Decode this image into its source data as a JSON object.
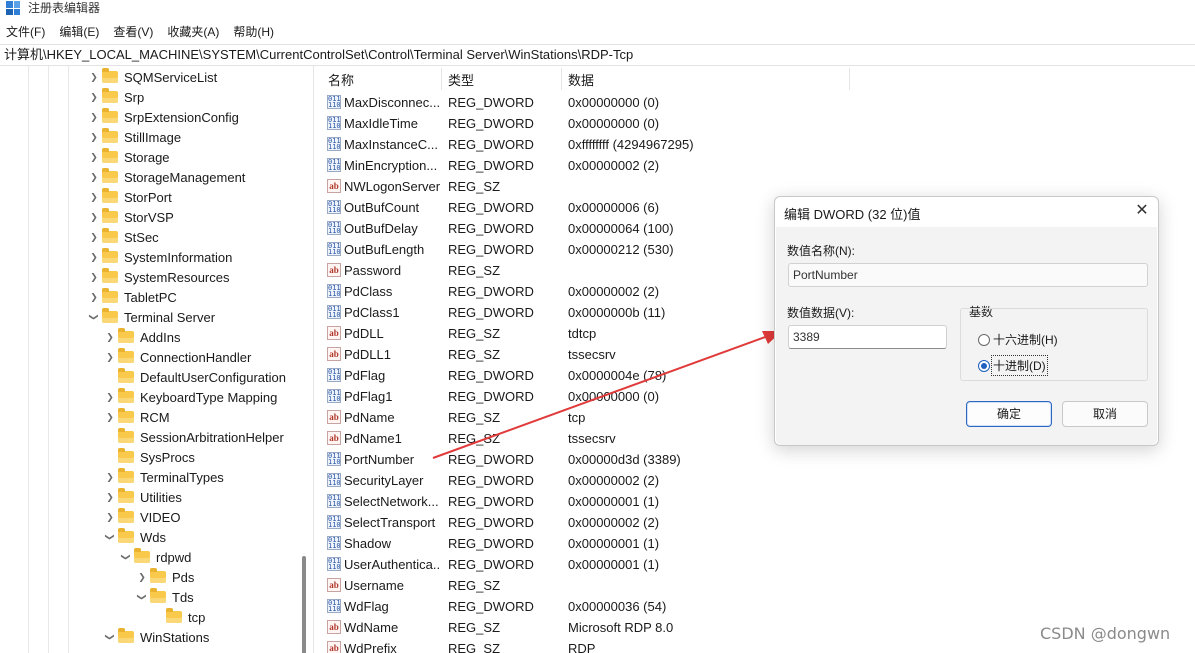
{
  "window": {
    "title": "注册表编辑器",
    "icon": "registry-editor-icon"
  },
  "menu": [
    "文件(F)",
    "编辑(E)",
    "查看(V)",
    "收藏夹(A)",
    "帮助(H)"
  ],
  "address": "计算机\\HKEY_LOCAL_MACHINE\\SYSTEM\\CurrentControlSet\\Control\\Terminal Server\\WinStations\\RDP-Tcp",
  "tree": [
    {
      "label": "SQMServiceList",
      "level": 0,
      "expander": "collapsed"
    },
    {
      "label": "Srp",
      "level": 0,
      "expander": "collapsed"
    },
    {
      "label": "SrpExtensionConfig",
      "level": 0,
      "expander": "collapsed"
    },
    {
      "label": "StillImage",
      "level": 0,
      "expander": "collapsed"
    },
    {
      "label": "Storage",
      "level": 0,
      "expander": "collapsed"
    },
    {
      "label": "StorageManagement",
      "level": 0,
      "expander": "collapsed"
    },
    {
      "label": "StorPort",
      "level": 0,
      "expander": "collapsed"
    },
    {
      "label": "StorVSP",
      "level": 0,
      "expander": "collapsed"
    },
    {
      "label": "StSec",
      "level": 0,
      "expander": "collapsed"
    },
    {
      "label": "SystemInformation",
      "level": 0,
      "expander": "collapsed"
    },
    {
      "label": "SystemResources",
      "level": 0,
      "expander": "collapsed"
    },
    {
      "label": "TabletPC",
      "level": 0,
      "expander": "collapsed"
    },
    {
      "label": "Terminal Server",
      "level": 0,
      "expander": "expanded"
    },
    {
      "label": "AddIns",
      "level": 1,
      "expander": "collapsed"
    },
    {
      "label": "ConnectionHandler",
      "level": 1,
      "expander": "collapsed"
    },
    {
      "label": "DefaultUserConfiguration",
      "level": 1,
      "expander": "none"
    },
    {
      "label": "KeyboardType Mapping",
      "level": 1,
      "expander": "collapsed"
    },
    {
      "label": "RCM",
      "level": 1,
      "expander": "collapsed"
    },
    {
      "label": "SessionArbitrationHelper",
      "level": 1,
      "expander": "none"
    },
    {
      "label": "SysProcs",
      "level": 1,
      "expander": "none"
    },
    {
      "label": "TerminalTypes",
      "level": 1,
      "expander": "collapsed"
    },
    {
      "label": "Utilities",
      "level": 1,
      "expander": "collapsed"
    },
    {
      "label": "VIDEO",
      "level": 1,
      "expander": "collapsed"
    },
    {
      "label": "Wds",
      "level": 1,
      "expander": "expanded"
    },
    {
      "label": "rdpwd",
      "level": 2,
      "expander": "expanded"
    },
    {
      "label": "Pds",
      "level": 3,
      "expander": "collapsed"
    },
    {
      "label": "Tds",
      "level": 3,
      "expander": "expanded"
    },
    {
      "label": "tcp",
      "level": 4,
      "expander": "none"
    },
    {
      "label": "WinStations",
      "level": 1,
      "expander": "expanded"
    }
  ],
  "columns": {
    "name": "名称",
    "type": "类型",
    "data": "数据"
  },
  "values": [
    {
      "name": "MaxDisconnec...",
      "type": "REG_DWORD",
      "data": "0x00000000 (0)",
      "icon": "dword-value-icon"
    },
    {
      "name": "MaxIdleTime",
      "type": "REG_DWORD",
      "data": "0x00000000 (0)",
      "icon": "dword-value-icon"
    },
    {
      "name": "MaxInstanceC...",
      "type": "REG_DWORD",
      "data": "0xffffffff (4294967295)",
      "icon": "dword-value-icon"
    },
    {
      "name": "MinEncryption...",
      "type": "REG_DWORD",
      "data": "0x00000002 (2)",
      "icon": "dword-value-icon"
    },
    {
      "name": "NWLogonServer",
      "type": "REG_SZ",
      "data": "",
      "icon": "string-value-icon"
    },
    {
      "name": "OutBufCount",
      "type": "REG_DWORD",
      "data": "0x00000006 (6)",
      "icon": "dword-value-icon"
    },
    {
      "name": "OutBufDelay",
      "type": "REG_DWORD",
      "data": "0x00000064 (100)",
      "icon": "dword-value-icon"
    },
    {
      "name": "OutBufLength",
      "type": "REG_DWORD",
      "data": "0x00000212 (530)",
      "icon": "dword-value-icon"
    },
    {
      "name": "Password",
      "type": "REG_SZ",
      "data": "",
      "icon": "string-value-icon"
    },
    {
      "name": "PdClass",
      "type": "REG_DWORD",
      "data": "0x00000002 (2)",
      "icon": "dword-value-icon"
    },
    {
      "name": "PdClass1",
      "type": "REG_DWORD",
      "data": "0x0000000b (11)",
      "icon": "dword-value-icon"
    },
    {
      "name": "PdDLL",
      "type": "REG_SZ",
      "data": "tdtcp",
      "icon": "string-value-icon"
    },
    {
      "name": "PdDLL1",
      "type": "REG_SZ",
      "data": "tssecsrv",
      "icon": "string-value-icon"
    },
    {
      "name": "PdFlag",
      "type": "REG_DWORD",
      "data": "0x0000004e (78)",
      "icon": "dword-value-icon"
    },
    {
      "name": "PdFlag1",
      "type": "REG_DWORD",
      "data": "0x00000000 (0)",
      "icon": "dword-value-icon"
    },
    {
      "name": "PdName",
      "type": "REG_SZ",
      "data": "tcp",
      "icon": "string-value-icon"
    },
    {
      "name": "PdName1",
      "type": "REG_SZ",
      "data": "tssecsrv",
      "icon": "string-value-icon"
    },
    {
      "name": "PortNumber",
      "type": "REG_DWORD",
      "data": "0x00000d3d (3389)",
      "icon": "dword-value-icon"
    },
    {
      "name": "SecurityLayer",
      "type": "REG_DWORD",
      "data": "0x00000002 (2)",
      "icon": "dword-value-icon"
    },
    {
      "name": "SelectNetwork...",
      "type": "REG_DWORD",
      "data": "0x00000001 (1)",
      "icon": "dword-value-icon"
    },
    {
      "name": "SelectTransport",
      "type": "REG_DWORD",
      "data": "0x00000002 (2)",
      "icon": "dword-value-icon"
    },
    {
      "name": "Shadow",
      "type": "REG_DWORD",
      "data": "0x00000001 (1)",
      "icon": "dword-value-icon"
    },
    {
      "name": "UserAuthentica...",
      "type": "REG_DWORD",
      "data": "0x00000001 (1)",
      "icon": "dword-value-icon"
    },
    {
      "name": "Username",
      "type": "REG_SZ",
      "data": "",
      "icon": "string-value-icon"
    },
    {
      "name": "WdFlag",
      "type": "REG_DWORD",
      "data": "0x00000036 (54)",
      "icon": "dword-value-icon"
    },
    {
      "name": "WdName",
      "type": "REG_SZ",
      "data": "Microsoft RDP 8.0",
      "icon": "string-value-icon"
    },
    {
      "name": "WdPrefix",
      "type": "REG_SZ",
      "data": "RDP",
      "icon": "string-value-icon"
    }
  ],
  "dialog": {
    "title": "编辑 DWORD (32 位)值",
    "close": "✕",
    "name_label": "数值名称(N):",
    "name_value": "PortNumber",
    "data_label": "数值数据(V):",
    "data_value": "3389",
    "base_label": "基数",
    "hex_label": "十六进制(H)",
    "dec_label": "十进制(D)",
    "selected_base": "dec",
    "ok": "确定",
    "cancel": "取消"
  },
  "annotation": {
    "arrow_color": "#e03a3a"
  },
  "watermark": "CSDN @dongwn"
}
